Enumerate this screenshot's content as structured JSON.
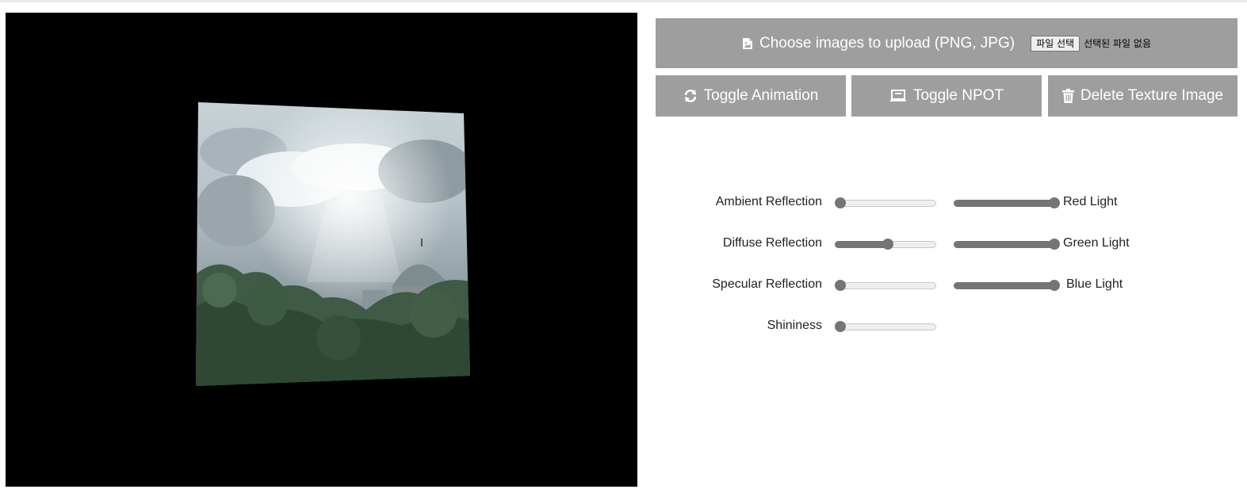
{
  "upload": {
    "label": "Choose images to upload (PNG, JPG)",
    "file_button": "파일 선택",
    "file_status": "선택된 파일 없음"
  },
  "buttons": {
    "toggle_animation": "Toggle Animation",
    "toggle_npot": "Toggle NPOT",
    "delete_texture": "Delete Texture Image"
  },
  "sliders": {
    "ambient": {
      "label": "Ambient Reflection",
      "value": 0.0
    },
    "diffuse": {
      "label": "Diffuse Reflection",
      "value": 0.5
    },
    "specular": {
      "label": "Specular Reflection",
      "value": 0.0
    },
    "shininess": {
      "label": "Shininess",
      "value": 0.0
    },
    "red": {
      "label": "Red Light",
      "value": 1.0
    },
    "green": {
      "label": "Green Light",
      "value": 1.0
    },
    "blue": {
      "label": "Blue Light",
      "value": 1.0
    }
  },
  "colors": {
    "button_bg": "#9e9e9e",
    "canvas_bg": "#000000",
    "slider_fill": "#757575"
  },
  "icons": {
    "upload": "file-image-icon",
    "animation": "sync-icon",
    "npot": "laptop-icon",
    "delete": "trash-icon"
  }
}
